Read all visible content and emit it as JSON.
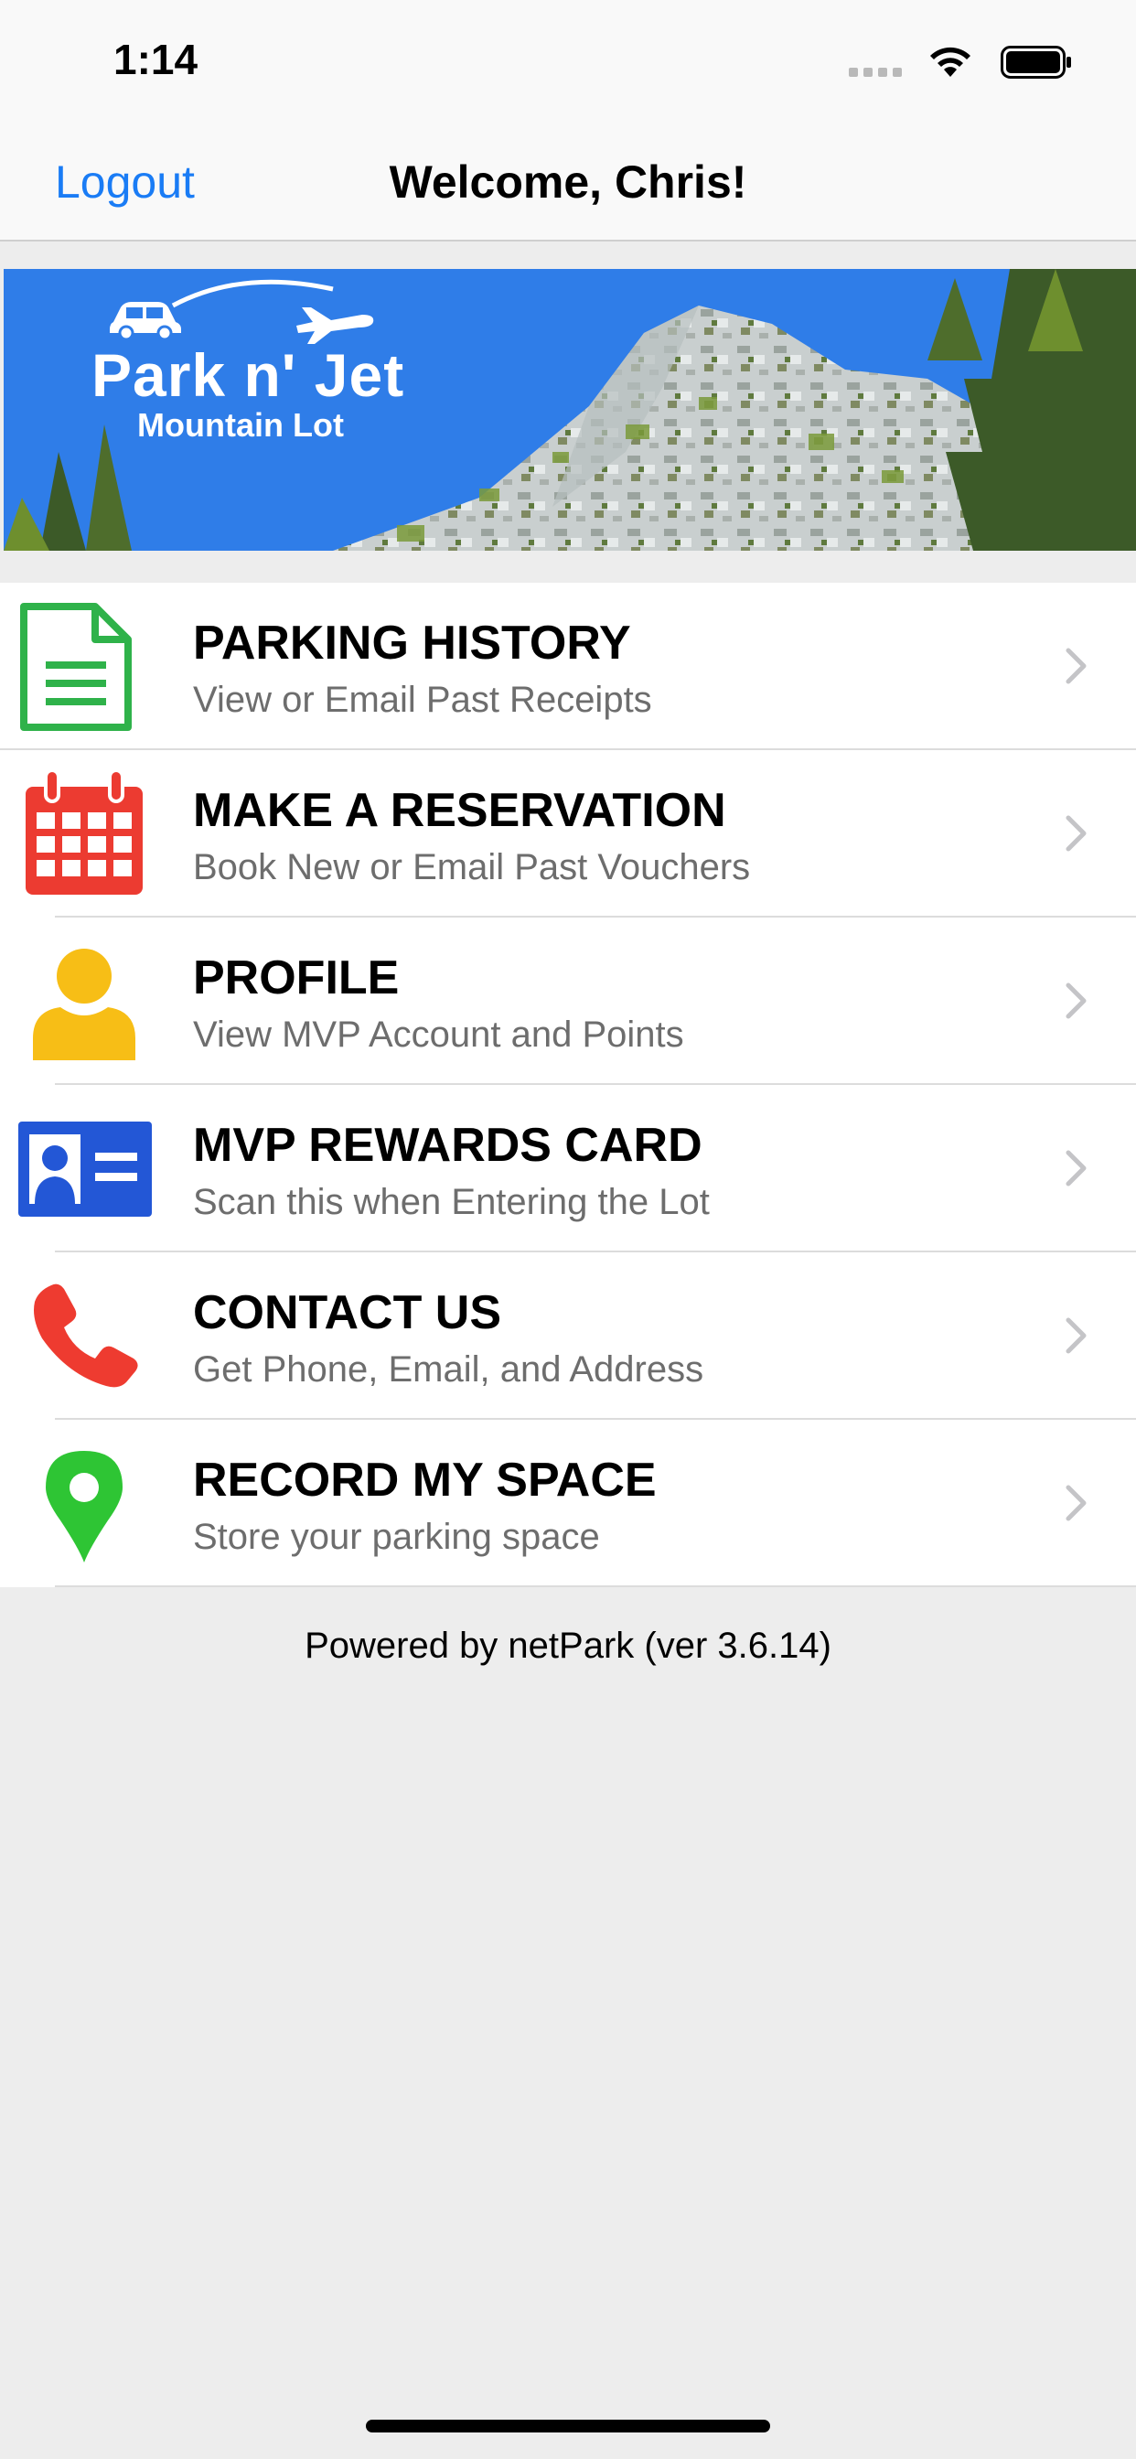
{
  "status_bar": {
    "time": "1:14",
    "icons": [
      "signal-icon",
      "wifi-icon",
      "battery-icon"
    ]
  },
  "nav": {
    "logout_label": "Logout",
    "title": "Welcome, Chris!"
  },
  "banner": {
    "brand_title": "Park n' Jet",
    "brand_subtitle": "Mountain Lot",
    "icons": [
      "car-icon",
      "airplane-icon"
    ]
  },
  "menu": {
    "items": [
      {
        "title": "PARKING HISTORY",
        "subtitle": "View or Email Past Receipts",
        "icon": "document-icon",
        "icon_color": "#2fb24a"
      },
      {
        "title": "MAKE A RESERVATION",
        "subtitle": "Book New or Email Past Vouchers",
        "icon": "calendar-icon",
        "icon_color": "#ec3b31"
      },
      {
        "title": "PROFILE",
        "subtitle": "View MVP Account and Points",
        "icon": "person-icon",
        "icon_color": "#f7be16"
      },
      {
        "title": "MVP REWARDS CARD",
        "subtitle": "Scan this when Entering the Lot",
        "icon": "id-card-icon",
        "icon_color": "#2357d6"
      },
      {
        "title": "CONTACT US",
        "subtitle": "Get Phone, Email, and Address",
        "icon": "phone-icon",
        "icon_color": "#ee3b30"
      },
      {
        "title": "RECORD MY SPACE",
        "subtitle": "Store your parking space",
        "icon": "map-pin-icon",
        "icon_color": "#2ec534"
      }
    ]
  },
  "footer": {
    "powered_by": "Powered by netPark (ver 3.6.14)"
  },
  "colors": {
    "accent": "#1a7cf5",
    "background": "#ededed",
    "banner_blue": "#2f7de8"
  }
}
